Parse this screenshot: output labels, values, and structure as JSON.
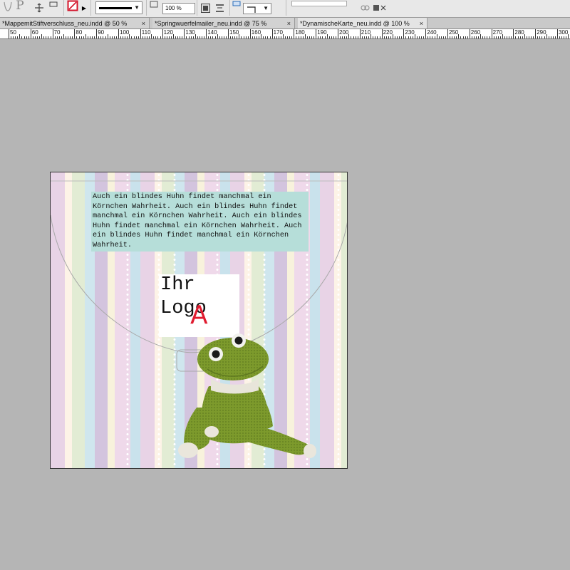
{
  "controlbar": {
    "stroke_weight_dropdown": "▼",
    "scale_value": "100 %",
    "colors": {
      "stroke_none_red": "#d4142a"
    }
  },
  "tabs": [
    {
      "label": "*MappemitStiftverschluss_neu.indd @ 50 %",
      "close": "×"
    },
    {
      "label": "*Springwuerfelmailer_neu.indd @ 75 %",
      "close": "×"
    },
    {
      "label": "*DynamischeKarte_neu.indd @ 100 %",
      "close": "×"
    }
  ],
  "ruler": {
    "labels": [
      "50",
      "60",
      "70",
      "80",
      "90",
      "100",
      "110",
      "120",
      "130",
      "140",
      "150",
      "160",
      "170",
      "180",
      "190",
      "200",
      "210",
      "220",
      "230",
      "240",
      "250",
      "260",
      "270",
      "280",
      "290",
      "300"
    ]
  },
  "document": {
    "body_text": "Auch ein blindes Huhn findet manchmal ein Körnchen Wahrheit. Auch ein blindes Huhn findet manchmal ein Körnchen Wahrheit. Auch ein blindes Huhn findet manchmal ein Körnchen Wahrheit. Auch ein blindes Huhn findet manchmal ein Körnchen Wahrheit.",
    "logo_line1": "Ihr",
    "logo_line2": "Logo",
    "logo_marker": "A",
    "colors": {
      "text_frame_fill": "#b6ded9",
      "logo_marker": "#e01b2f",
      "frog_green": "#7d9a2c"
    }
  }
}
